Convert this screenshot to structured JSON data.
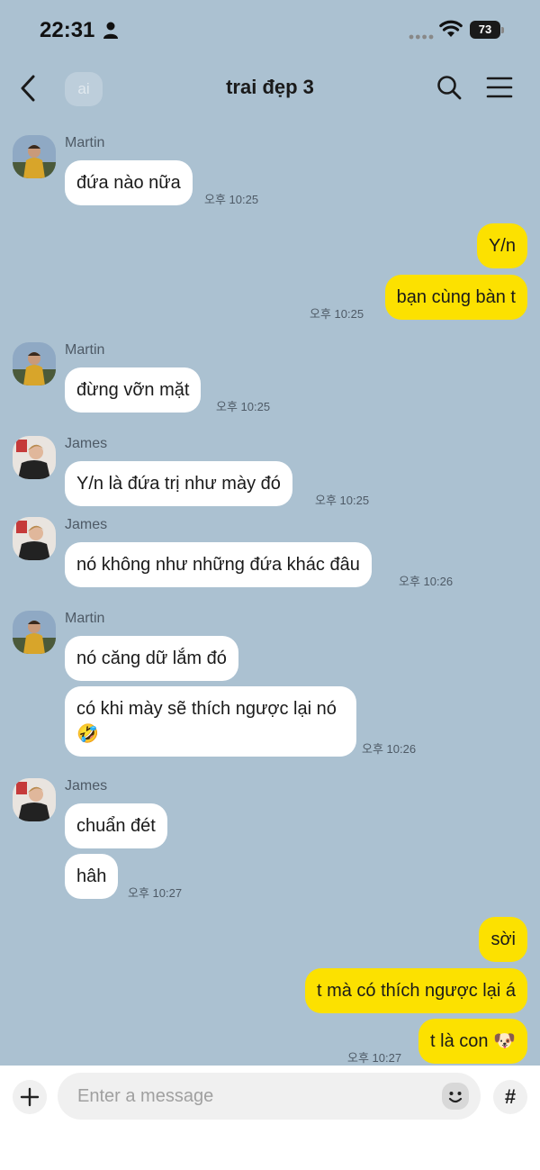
{
  "status_bar": {
    "time": "22:31",
    "battery": "73"
  },
  "header": {
    "title": "trai đẹp 3",
    "ghost_text": "ai"
  },
  "messages": [
    {
      "type": "in",
      "sender": "Martin",
      "text": "đứa nào nữa",
      "time": "오후 10:25"
    },
    {
      "type": "out",
      "text": "Y/n"
    },
    {
      "type": "out",
      "text": "bạn cùng bàn t",
      "time": "오후 10:25"
    },
    {
      "type": "in",
      "sender": "Martin",
      "text": "đừng vỡn mặt",
      "time": "오후 10:25"
    },
    {
      "type": "in",
      "sender": "James",
      "text": "Y/n là đứa trị như mày đó",
      "time": "오후 10:25"
    },
    {
      "type": "in",
      "sender": "James",
      "text": "nó không như những đứa khác đâu",
      "time": "오후 10:26"
    },
    {
      "type": "in",
      "sender": "Martin",
      "text": "nó căng dữ lắm đó"
    },
    {
      "type": "in",
      "text": "có khi mày sẽ thích ngược lại nó 🤣",
      "time": "오후 10:26"
    },
    {
      "type": "in",
      "sender": "James",
      "text": "chuẩn đét"
    },
    {
      "type": "in",
      "text": "hâh",
      "time": "오후 10:27"
    },
    {
      "type": "out",
      "text": "sời"
    },
    {
      "type": "out",
      "text": "t mà có thích ngược lại á"
    },
    {
      "type": "out",
      "text": "t là con 🐶",
      "time": "오후 10:27"
    }
  ],
  "input": {
    "placeholder": "Enter a message"
  },
  "icons": {
    "back": "chevron-left-icon",
    "search": "search-icon",
    "menu": "hamburger-menu-icon",
    "plus": "plus-icon",
    "emoji": "emoji-icon",
    "hash": "#"
  },
  "colors": {
    "chat_background": "#abc1d1",
    "outgoing_bubble": "#fce100",
    "incoming_bubble": "#ffffff"
  }
}
